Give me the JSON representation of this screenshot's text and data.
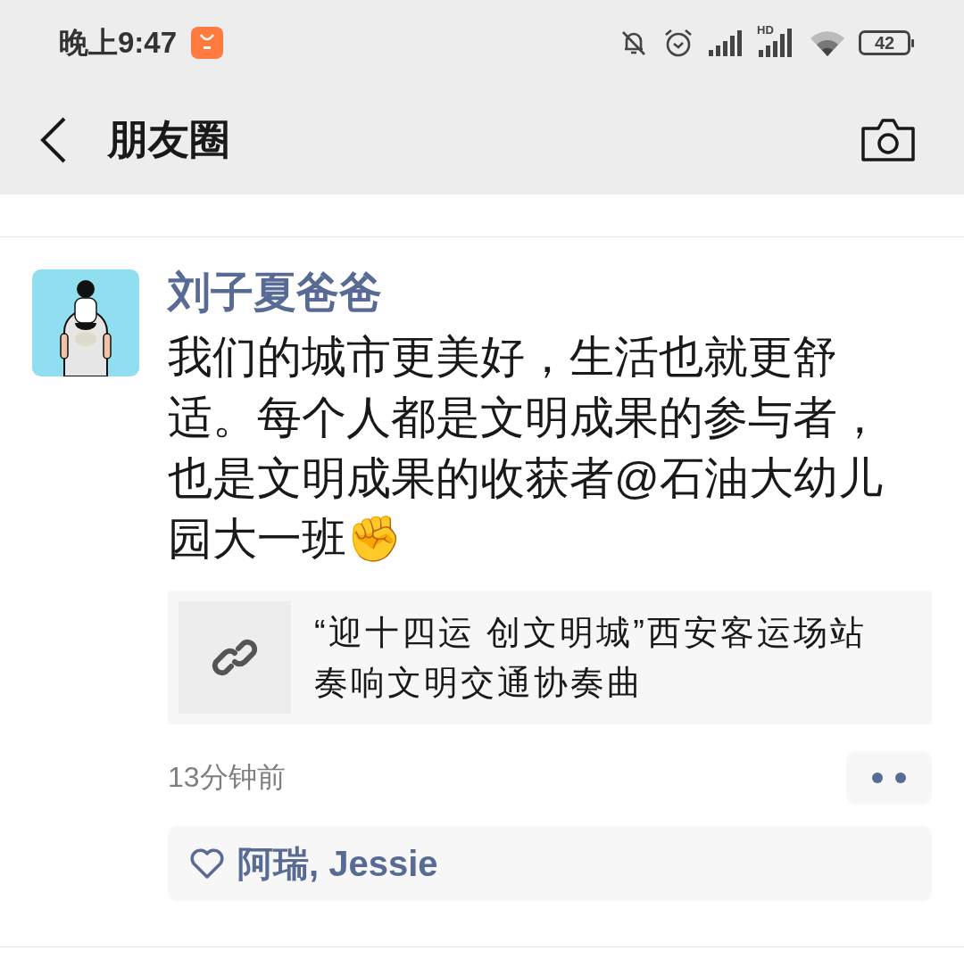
{
  "status_bar": {
    "time": "晚上9:47",
    "signal_label": "HD",
    "battery": "42"
  },
  "header": {
    "title": "朋友圈"
  },
  "post": {
    "author": "刘子夏爸爸",
    "text": "我们的城市更美好，生活也就更舒适。每个人都是文明成果的参与者，也是文明成果的收获者@石油大幼儿园大一班✊",
    "link": {
      "title": "“迎十四运 创文明城”西安客运场站奏响文明交通协奏曲"
    },
    "time": "13分钟前",
    "likes": "阿瑞, Jessie"
  }
}
